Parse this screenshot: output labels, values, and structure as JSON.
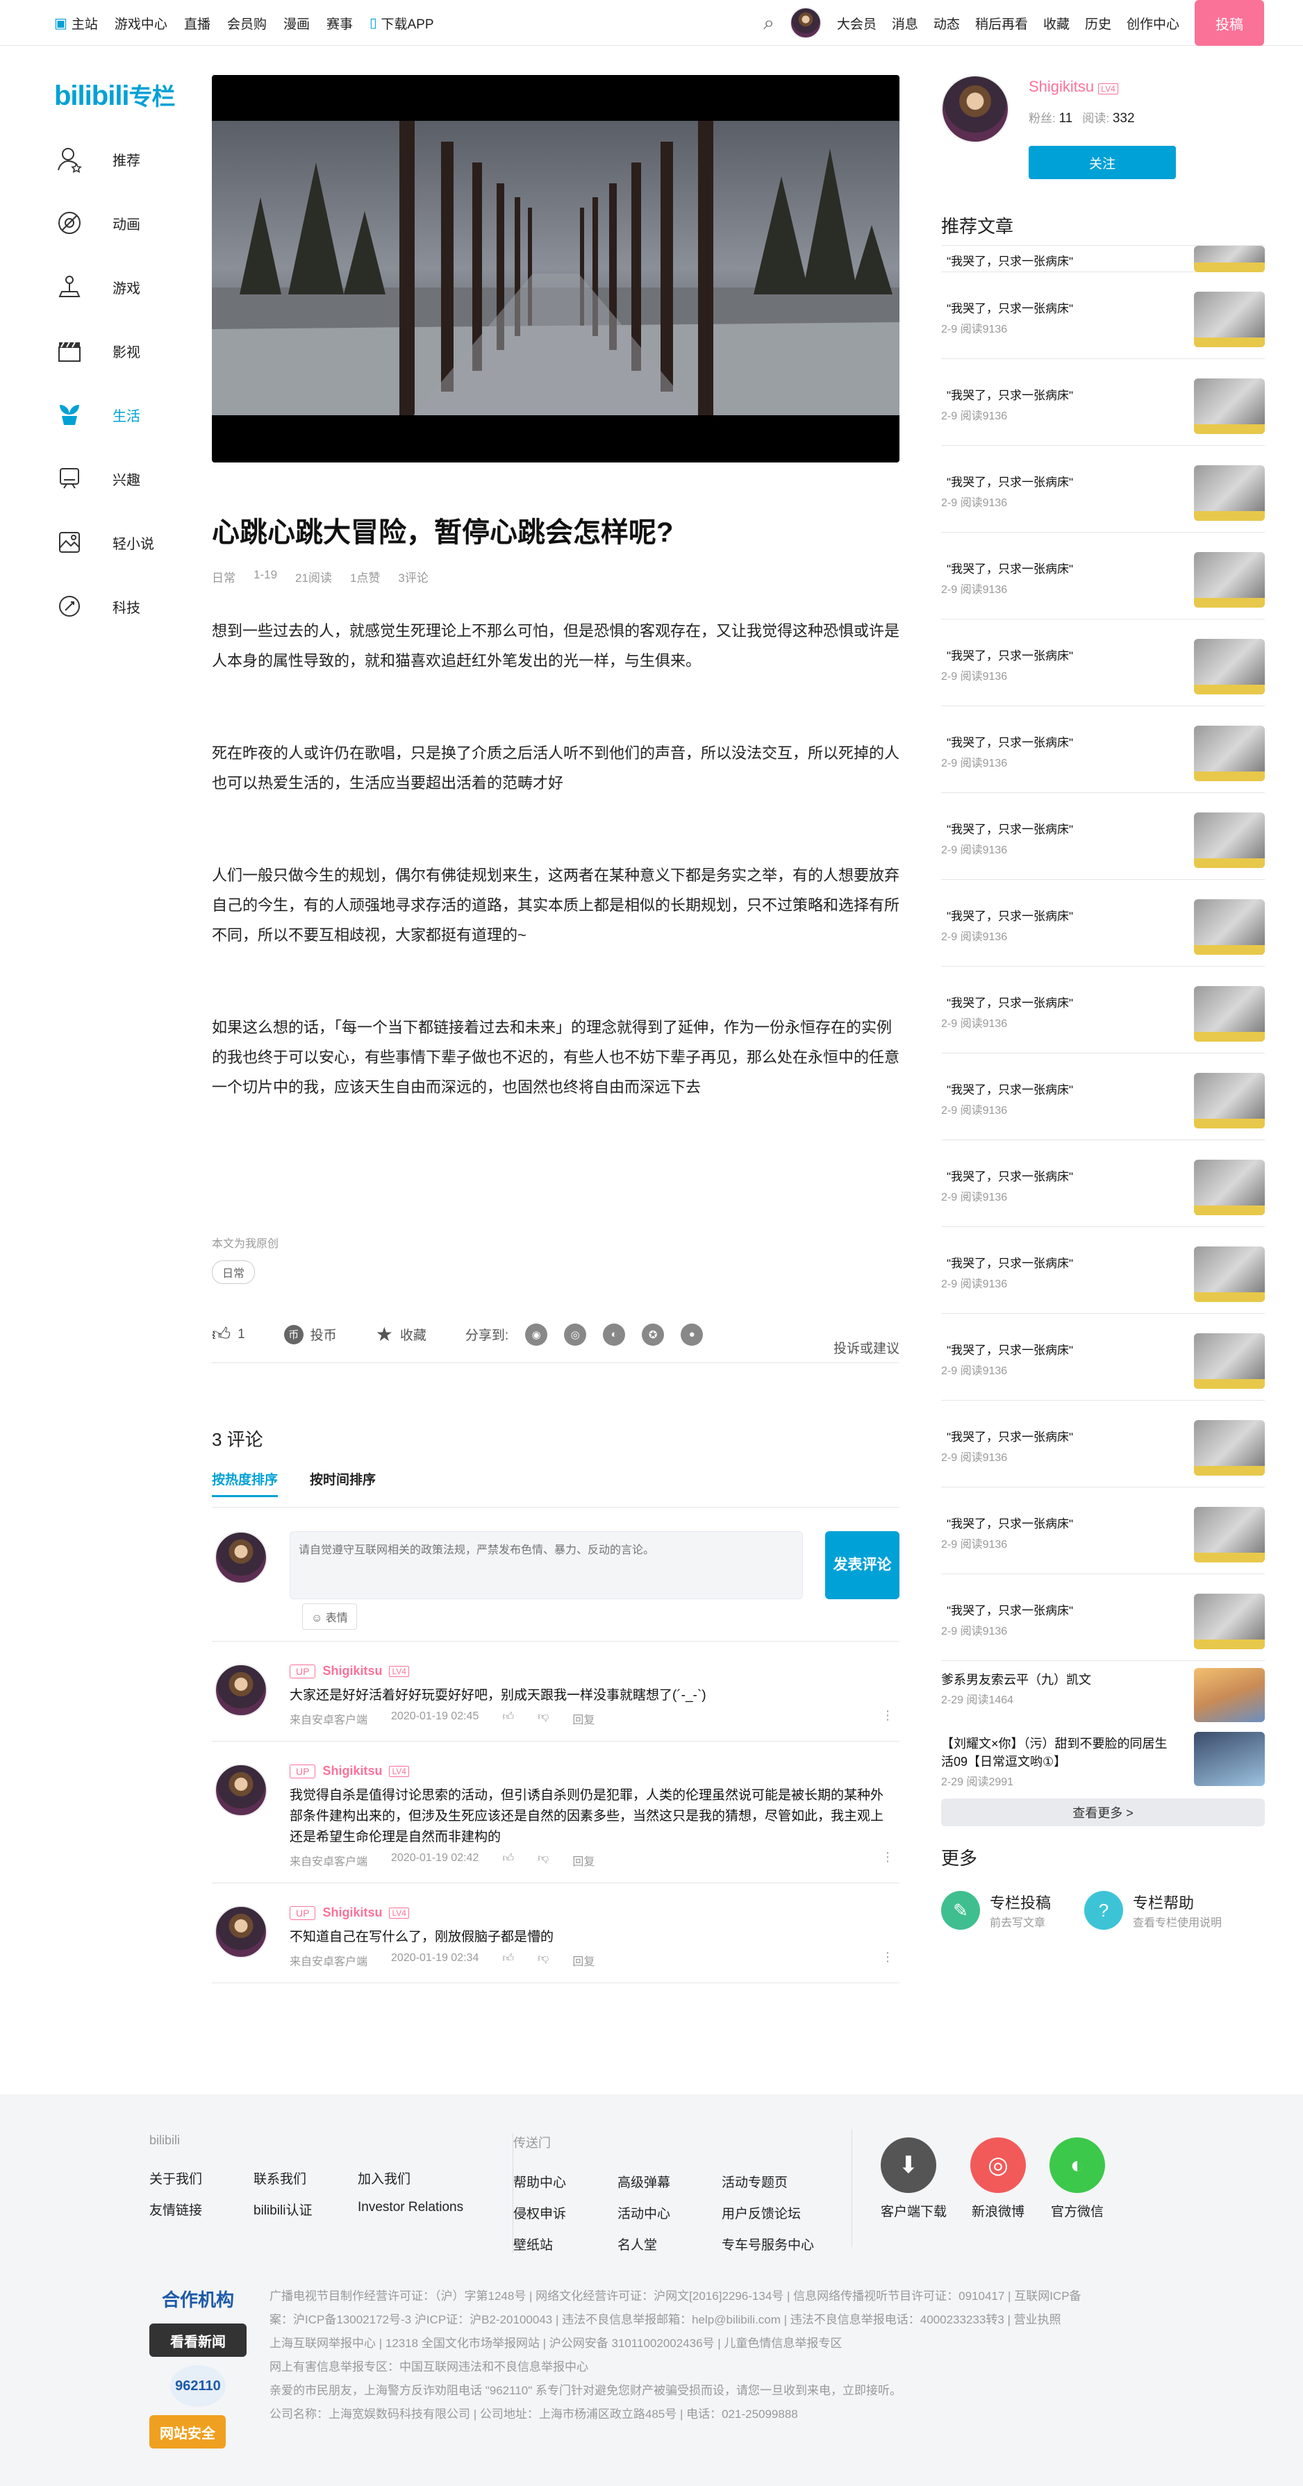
{
  "topbar": {
    "nav": [
      "主站",
      "游戏中心",
      "直播",
      "会员购",
      "漫画",
      "赛事",
      "下载APP"
    ],
    "right": [
      "大会员",
      "消息",
      "动态",
      "稍后再看",
      "收藏",
      "历史",
      "创作中心"
    ],
    "publish": "投稿"
  },
  "sidebar": {
    "logo": "bilibili",
    "logo_suffix": "专栏",
    "items": [
      {
        "label": "推荐",
        "icon": "user-star-icon"
      },
      {
        "label": "动画",
        "icon": "animation-icon"
      },
      {
        "label": "游戏",
        "icon": "joystick-icon"
      },
      {
        "label": "影视",
        "icon": "clapperboard-icon"
      },
      {
        "label": "生活",
        "icon": "plant-icon"
      },
      {
        "label": "兴趣",
        "icon": "monitor-icon"
      },
      {
        "label": "轻小说",
        "icon": "image-book-icon"
      },
      {
        "label": "科技",
        "icon": "rocket-icon"
      }
    ],
    "active": "生活"
  },
  "article": {
    "title": "心跳心跳大冒险，暂停心跳会怎样呢?",
    "meta": [
      "日常",
      "1-19",
      "21阅读",
      "1点赞",
      "3评论"
    ],
    "paragraphs": [
      "想到一些过去的人，就感觉生死理论上不那么可怕，但是恐惧的客观存在，又让我觉得这种恐惧或许是人本身的属性导致的，就和猫喜欢追赶红外笔发出的光一样，与生俱来。",
      "死在昨夜的人或许仍在歌唱，只是换了介质之后活人听不到他们的声音，所以没法交互，所以死掉的人也可以热爱生活的，生活应当要超出活着的范畴才好",
      "人们一般只做今生的规划，偶尔有佛徒规划来生，这两者在某种意义下都是务实之举，有的人想要放弃自己的今生，有的人顽强地寻求存活的道路，其实本质上都是相似的长期规划，只不过策略和选择有所不同，所以不要互相歧视，大家都挺有道理的~",
      "如果这么想的话，「每一个当下都链接着过去和未来」的理念就得到了延伸，作为一份永恒存在的实例的我也终于可以安心，有些事情下辈子做也不迟的，有些人也不妨下辈子再见，那么处在永恒中的任意一个切片中的我，应该天生自由而深远的，也固然也终将自由而深远下去"
    ],
    "original_note": "本文为我原创",
    "tag": "日常"
  },
  "actions": {
    "like": "1",
    "coin": "投币",
    "fav": "收藏",
    "share": "分享到:",
    "report": "投诉或建议"
  },
  "comments": {
    "count_label": "3 评论",
    "tab_hot": "按热度排序",
    "tab_time": "按时间排序",
    "placeholder": "请自觉遵守互联网相关的政策法规，严禁发布色情、暴力、反动的言论。",
    "send": "发表评论",
    "emoji": "表情",
    "items": [
      {
        "badge": "UP",
        "user": "Shigikitsu",
        "level": "LV4",
        "text": "大家还是好好活着好好玩耍好好吧，别成天跟我一样没事就瞎想了(´-_-`)",
        "source": "来自安卓客户端",
        "time": "2020-01-19 02:45",
        "reply": "回复"
      },
      {
        "badge": "UP",
        "user": "Shigikitsu",
        "level": "LV4",
        "text": "我觉得自杀是值得讨论思索的活动，但引诱自杀则仍是犯罪，人类的伦理虽然说可能是被长期的某种外部条件建构出来的，但涉及生死应该还是自然的因素多些，当然这只是我的猜想，尽管如此，我主观上还是希望生命伦理是自然而非建构的",
        "source": "来自安卓客户端",
        "time": "2020-01-19 02:42",
        "reply": "回复"
      },
      {
        "badge": "UP",
        "user": "Shigikitsu",
        "level": "LV4",
        "text": "不知道自己在写什么了，刚放假脑子都是懵的",
        "source": "来自安卓客户端",
        "time": "2020-01-19 02:34",
        "reply": "回复"
      }
    ]
  },
  "author": {
    "name": "Shigikitsu",
    "level": "LV4",
    "fans_label": "粉丝:",
    "fans": "11",
    "read_label": "阅读:",
    "reads": "332",
    "follow": "关注"
  },
  "recommend": {
    "heading": "推荐文章",
    "items": [
      {
        "title": "\"我哭了，只求一张病床\"",
        "date": ""
      },
      {
        "title": "\"我哭了，只求一张病床\"",
        "date": "2-9 阅读9136"
      },
      {
        "title": "\"我哭了，只求一张病床\"",
        "date": "2-9 阅读9136"
      },
      {
        "title": "\"我哭了，只求一张病床\"",
        "date": "2-9 阅读9136"
      },
      {
        "title": "\"我哭了，只求一张病床\"",
        "date": "2-9 阅读9136"
      },
      {
        "title": "\"我哭了，只求一张病床\"",
        "date": "2-9 阅读9136"
      },
      {
        "title": "\"我哭了，只求一张病床\"",
        "date": "2-9 阅读9136"
      },
      {
        "title": "\"我哭了，只求一张病床\"",
        "date": "2-9 阅读9136"
      },
      {
        "title": "\"我哭了，只求一张病床\"",
        "date": "2-9 阅读9136"
      },
      {
        "title": "\"我哭了，只求一张病床\"",
        "date": "2-9 阅读9136"
      },
      {
        "title": "\"我哭了，只求一张病床\"",
        "date": "2-9 阅读9136"
      },
      {
        "title": "\"我哭了，只求一张病床\"",
        "date": "2-9 阅读9136"
      },
      {
        "title": "\"我哭了，只求一张病床\"",
        "date": "2-9 阅读9136"
      },
      {
        "title": "\"我哭了，只求一张病床\"",
        "date": "2-9 阅读9136"
      },
      {
        "title": "\"我哭了，只求一张病床\"",
        "date": "2-9 阅读9136"
      },
      {
        "title": "\"我哭了，只求一张病床\"",
        "date": "2-9 阅读9136"
      },
      {
        "title": "\"我哭了，只求一张病床\"",
        "date": "2-9 阅读9136"
      }
    ],
    "extra": [
      {
        "title": "爹系男友索云平（九）凯文",
        "date": "2-29 阅读1464"
      },
      {
        "title": "【刘耀文×你】（污）甜到不要脸的同居生活09【日常逗文哟①】",
        "date": "2-29 阅读2991"
      }
    ],
    "more": "查看更多 >"
  },
  "more": {
    "heading": "更多",
    "items": [
      {
        "t1": "专栏投稿",
        "t2": "前去写文章"
      },
      {
        "t1": "专栏帮助",
        "t2": "查看专栏使用说明"
      }
    ]
  },
  "footer": {
    "col1_label": "bilibili",
    "col1": [
      "关于我们",
      "联系我们",
      "加入我们",
      "友情链接",
      "bilibili认证",
      "Investor Relations"
    ],
    "col2_label": "传送门",
    "col2": [
      "帮助中心",
      "高级弹幕",
      "活动专题页",
      "侵权申诉",
      "活动中心",
      "用户反馈论坛",
      "壁纸站",
      "名人堂",
      "专车号服务中心"
    ],
    "apps": [
      "客户端下载",
      "新浪微博",
      "官方微信"
    ],
    "lines": [
      "广播电视节目制作经营许可证：（沪）字第1248号 | 网络文化经营许可证：沪网文[2016]2296-134号 | 信息网络传播视听节目许可证：0910417 | 互联网ICP备案：沪ICP备13002172号-3 沪ICP证：沪B2-20100043 | 违法不良信息举报邮箱：help@bilibili.com | 违法不良信息举报电话：4000233233转3 | 营业执照",
      "上海互联网举报中心 | 12318 全国文化市场举报网站 | 沪公网安备 31011002002436号 | 儿童色情信息举报专区",
      "网上有害信息举报专区：中国互联网违法和不良信息举报中心",
      "亲爱的市民朋友，上海警方反诈劝阻电话 \"962110\" 系专门针对避免您财产被骗受损而设，请您一旦收到来电，立即接听。",
      "公司名称：上海宽娱数码科技有限公司 | 公司地址：上海市杨浦区政立路485号 | 电话：021-25099888"
    ],
    "logos": [
      "合作机构",
      "看看新闻",
      "962110",
      "网站安全"
    ]
  },
  "colors": {
    "accent": "#00a1d6",
    "pink": "#fb7299"
  }
}
